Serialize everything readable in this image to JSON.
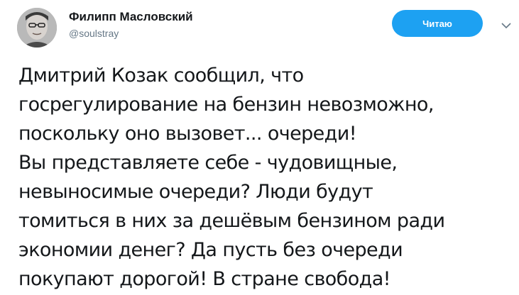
{
  "author": {
    "name": "Филипп Масловский",
    "handle": "@soulstray",
    "avatar_icon": "profile-photo"
  },
  "follow_button": {
    "label": "Читаю",
    "color": "#1da1f2"
  },
  "menu": {
    "icon": "chevron-down-icon"
  },
  "tweet": {
    "lines": [
      "Дмитрий Козак сообщил, что",
      "госрегулирование на бензин невозможно,",
      "поскольку оно вызовет... очереди!",
      "Вы представляете себе - чудовищные,",
      "невыносимые очереди? Люди будут",
      "томиться в них за дешёвым бензином ради",
      "экономии денег? Да пусть без очереди",
      "покупают дорогой! В стране свобода!"
    ]
  },
  "colors": {
    "text": "#14171a",
    "secondary": "#657786",
    "accent": "#1da1f2"
  }
}
